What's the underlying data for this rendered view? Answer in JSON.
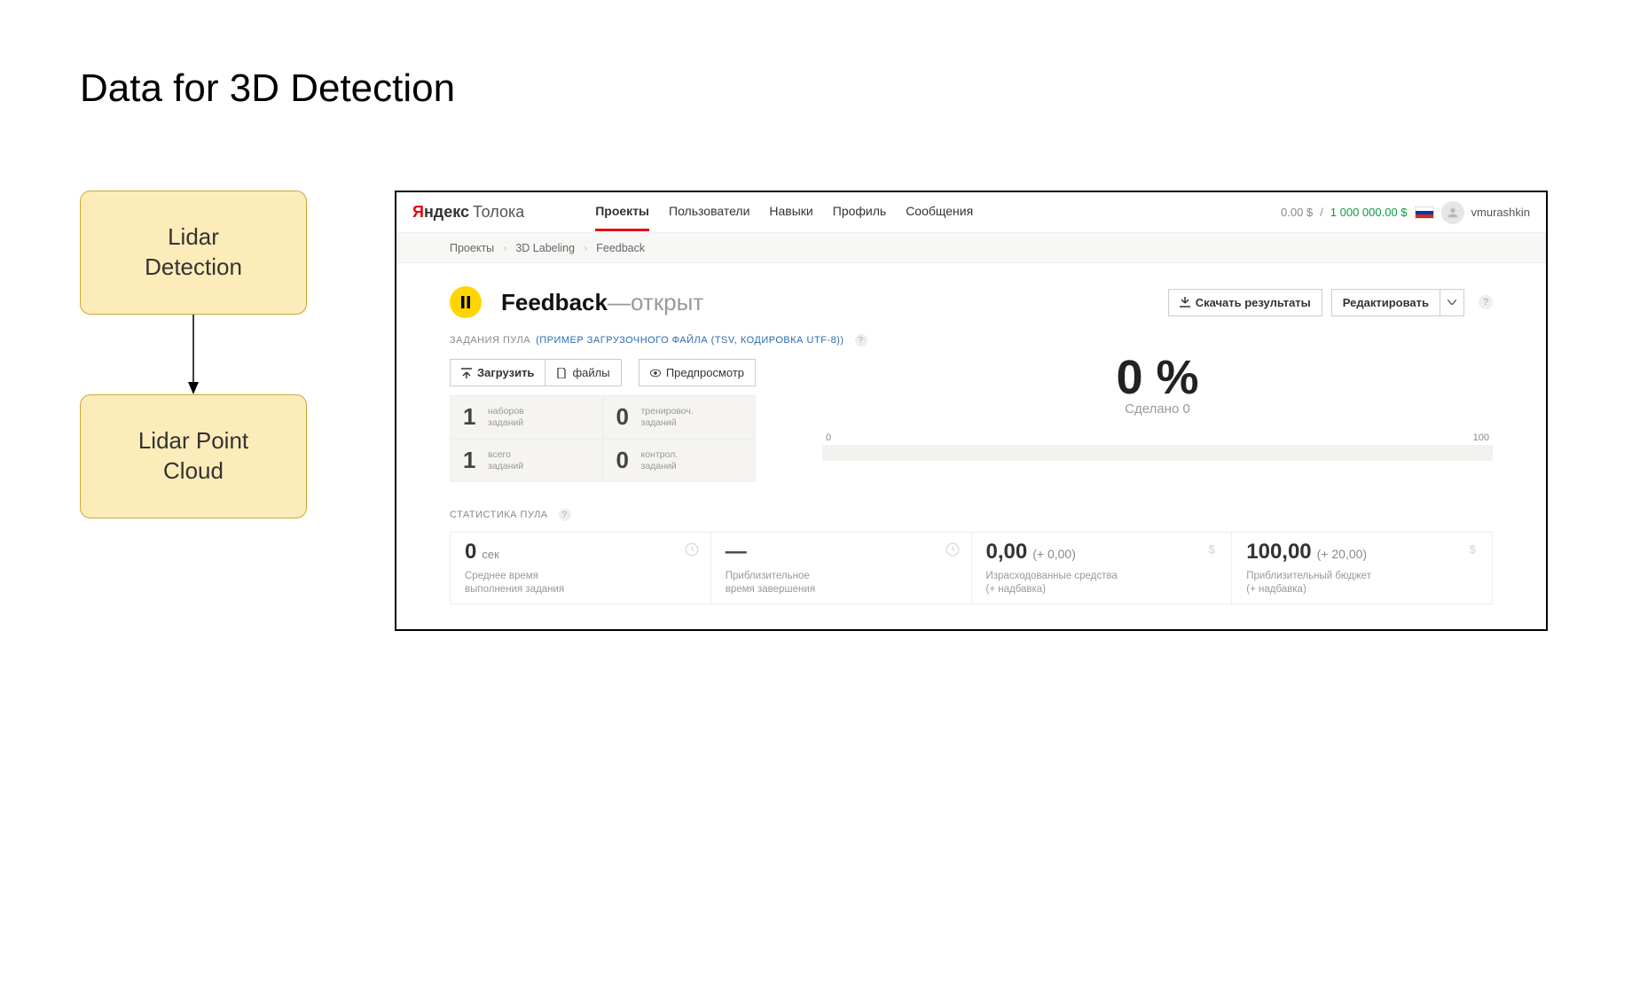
{
  "slide_title": "Data for 3D Detection",
  "diagram": {
    "box1": "Lidar\nDetection",
    "box2": "Lidar Point\nCloud"
  },
  "brand": {
    "yandex_y": "Я",
    "yandex_rest": "ндекс",
    "toloka": "Толока"
  },
  "nav": {
    "projects": "Проекты",
    "users": "Пользователи",
    "skills": "Навыки",
    "profile": "Профиль",
    "messages": "Сообщения"
  },
  "balance": {
    "zero": "0.00 $",
    "sep": "/",
    "million": "1 000 000.00 $"
  },
  "user": {
    "name": "vmurashkin"
  },
  "breadcrumbs": {
    "root": "Проекты",
    "project": "3D Labeling",
    "current": "Feedback"
  },
  "page": {
    "title": "Feedback",
    "status_dash": " — ",
    "status": "открыт",
    "download": "Скачать результаты",
    "edit": "Редактировать"
  },
  "pool_tasks": {
    "label": "ЗАДАНИЯ ПУЛА",
    "example_link": "(Пример загрузочного файла (tsv, кодировка UTF-8))",
    "upload": "Загрузить",
    "files": "файлы",
    "preview": "Предпросмотр",
    "stats": [
      {
        "num": "1",
        "label": "наборов\nзаданий"
      },
      {
        "num": "0",
        "label": "тренировоч.\nзаданий"
      },
      {
        "num": "1",
        "label": "всего\nзаданий"
      },
      {
        "num": "0",
        "label": "контрол.\nзаданий"
      }
    ]
  },
  "progress": {
    "pct": "0 %",
    "done": "Сделано 0",
    "min": "0",
    "max": "100"
  },
  "pool_stats": {
    "label": "СТАТИСТИКА ПУЛА",
    "cells": [
      {
        "big": "0",
        "unit": "сек",
        "desc": "Среднее время\nвыполнения задания"
      },
      {
        "big": "—",
        "unit": "",
        "desc": "Приблизительное\nвремя завершения"
      },
      {
        "big": "0,00",
        "sub": "(+ 0,00)",
        "desc": "Израсходованные средства\n(+ надбавка)"
      },
      {
        "big": "100,00",
        "sub": "(+ 20,00)",
        "desc": "Приблизительный бюджет\n(+ надбавка)"
      }
    ]
  }
}
